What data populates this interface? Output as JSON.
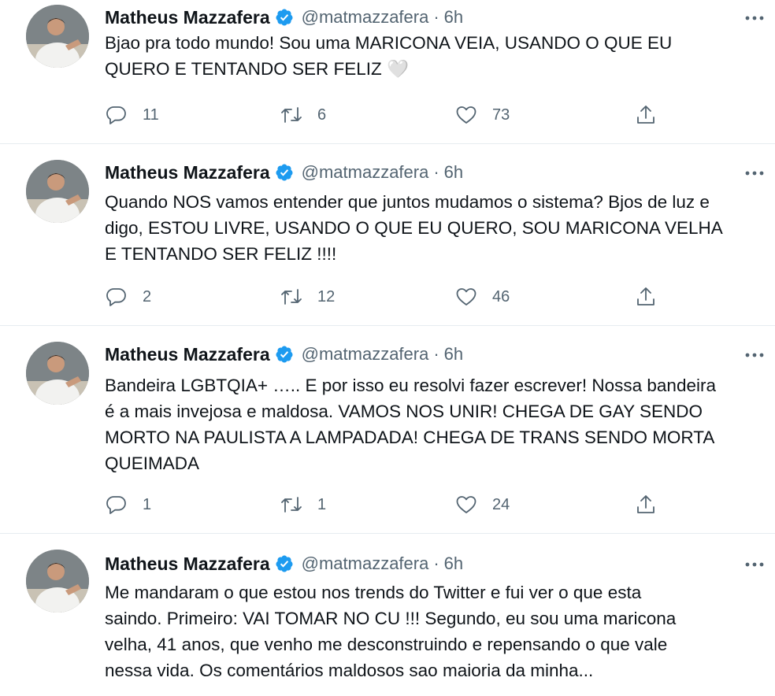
{
  "tweets": [
    {
      "name": "Matheus Mazzafera",
      "handle": "@matmazzafera",
      "separator": "·",
      "time": "6h",
      "lines": [
        "Bjao pra todo mundo! Sou uma MARICONA VEIA, USANDO O QUE EU",
        "QUERO E TENTANDO SER FELIZ 🤍"
      ],
      "replies": "11",
      "retweets": "6",
      "likes": "73"
    },
    {
      "name": "Matheus Mazzafera",
      "handle": "@matmazzafera",
      "separator": "·",
      "time": "6h",
      "lines": [
        "Quando NOS vamos entender que juntos mudamos o sistema? Bjos de luz e",
        "digo, ESTOU LIVRE, USANDO O QUE EU QUERO, SOU MARICONA VELHA",
        "E TENTANDO SER FELIZ !!!!"
      ],
      "replies": "2",
      "retweets": "12",
      "likes": "46"
    },
    {
      "name": "Matheus Mazzafera",
      "handle": "@matmazzafera",
      "separator": "·",
      "time": "6h",
      "lines": [
        "Bandeira LGBTQIA+ ….. E por isso eu resolvi fazer escrever! Nossa bandeira",
        "é  a mais invejosa e maldosa. VAMOS NOS UNIR! CHEGA DE GAY SENDO",
        "MORTO NA PAULISTA A LAMPADADA! CHEGA DE TRANS SENDO MORTA",
        "QUEIMADA"
      ],
      "replies": "1",
      "retweets": "1",
      "likes": "24"
    },
    {
      "name": "Matheus Mazzafera",
      "handle": "@matmazzafera",
      "separator": "·",
      "time": "6h",
      "lines": [
        "Me mandaram o que estou nos trends do Twitter e fui ver o que esta",
        "saindo. Primeiro: VAI TOMAR NO CU !!! Segundo, eu sou uma maricona",
        "velha, 41 anos, que venho me desconstruindo e repensando o que vale",
        "nessa vida. Os comentários maldosos sao maioria da minha..."
      ]
    }
  ],
  "icons": {
    "verified": "verified-badge-icon",
    "more": "more-options-icon",
    "reply": "reply-icon",
    "retweet": "retweet-icon",
    "like": "heart-icon",
    "share": "share-icon"
  },
  "colors": {
    "verified_blue": "#1d9bf0",
    "secondary_text": "#536471",
    "divider": "#e6ecf0"
  }
}
